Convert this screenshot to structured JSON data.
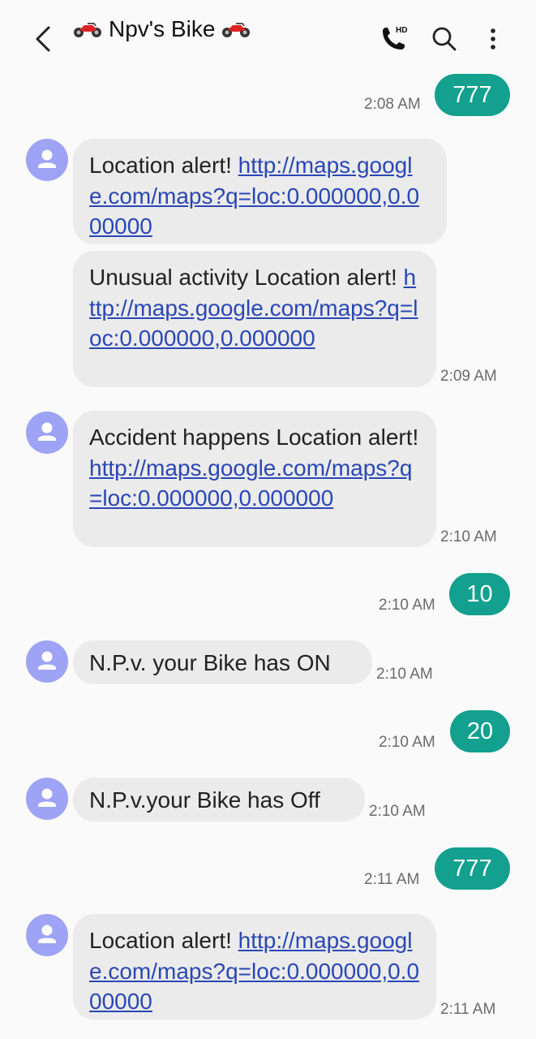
{
  "header": {
    "title": "Npv's Bike",
    "icons": [
      "back-arrow-icon",
      "motorcycle-emoji-icon",
      "hd-voice-call-icon",
      "search-icon",
      "more-options-icon"
    ]
  },
  "messages": [
    {
      "dir": "out",
      "text": "777",
      "time": "2:08 AM"
    },
    {
      "dir": "in",
      "prefix": "Location alert! ",
      "link": "http://maps.google.com/maps?q=loc:0.000000,0.000000",
      "time": ""
    },
    {
      "dir": "in",
      "prefix": "Unusual activity Location alert! ",
      "link": "http://maps.google.com/maps?q=loc:0.000000,0.000000",
      "time": "2:09 AM"
    },
    {
      "dir": "in",
      "prefix": "Accident happens Location alert! ",
      "link": "http://maps.google.com/maps?q=loc:0.000000,0.000000",
      "time": "2:10 AM"
    },
    {
      "dir": "out",
      "text": "10",
      "time": "2:10 AM"
    },
    {
      "dir": "in",
      "prefix": "N.P.v. your Bike has ON",
      "time": "2:10 AM"
    },
    {
      "dir": "out",
      "text": "20",
      "time": "2:10 AM"
    },
    {
      "dir": "in",
      "prefix": "N.P.v.your Bike has Off",
      "time": "2:10 AM"
    },
    {
      "dir": "out",
      "text": "777",
      "time": "2:11 AM"
    },
    {
      "dir": "in",
      "prefix": "Location alert! ",
      "link": "http://maps.google.com/maps?q=loc:0.000000,0.000000",
      "time": "2:11 AM"
    }
  ],
  "colors": {
    "sent_bubble": "#13a08e",
    "received_bubble": "#ebebeb",
    "avatar": "#9ea3f5",
    "link": "#2a47b6"
  }
}
